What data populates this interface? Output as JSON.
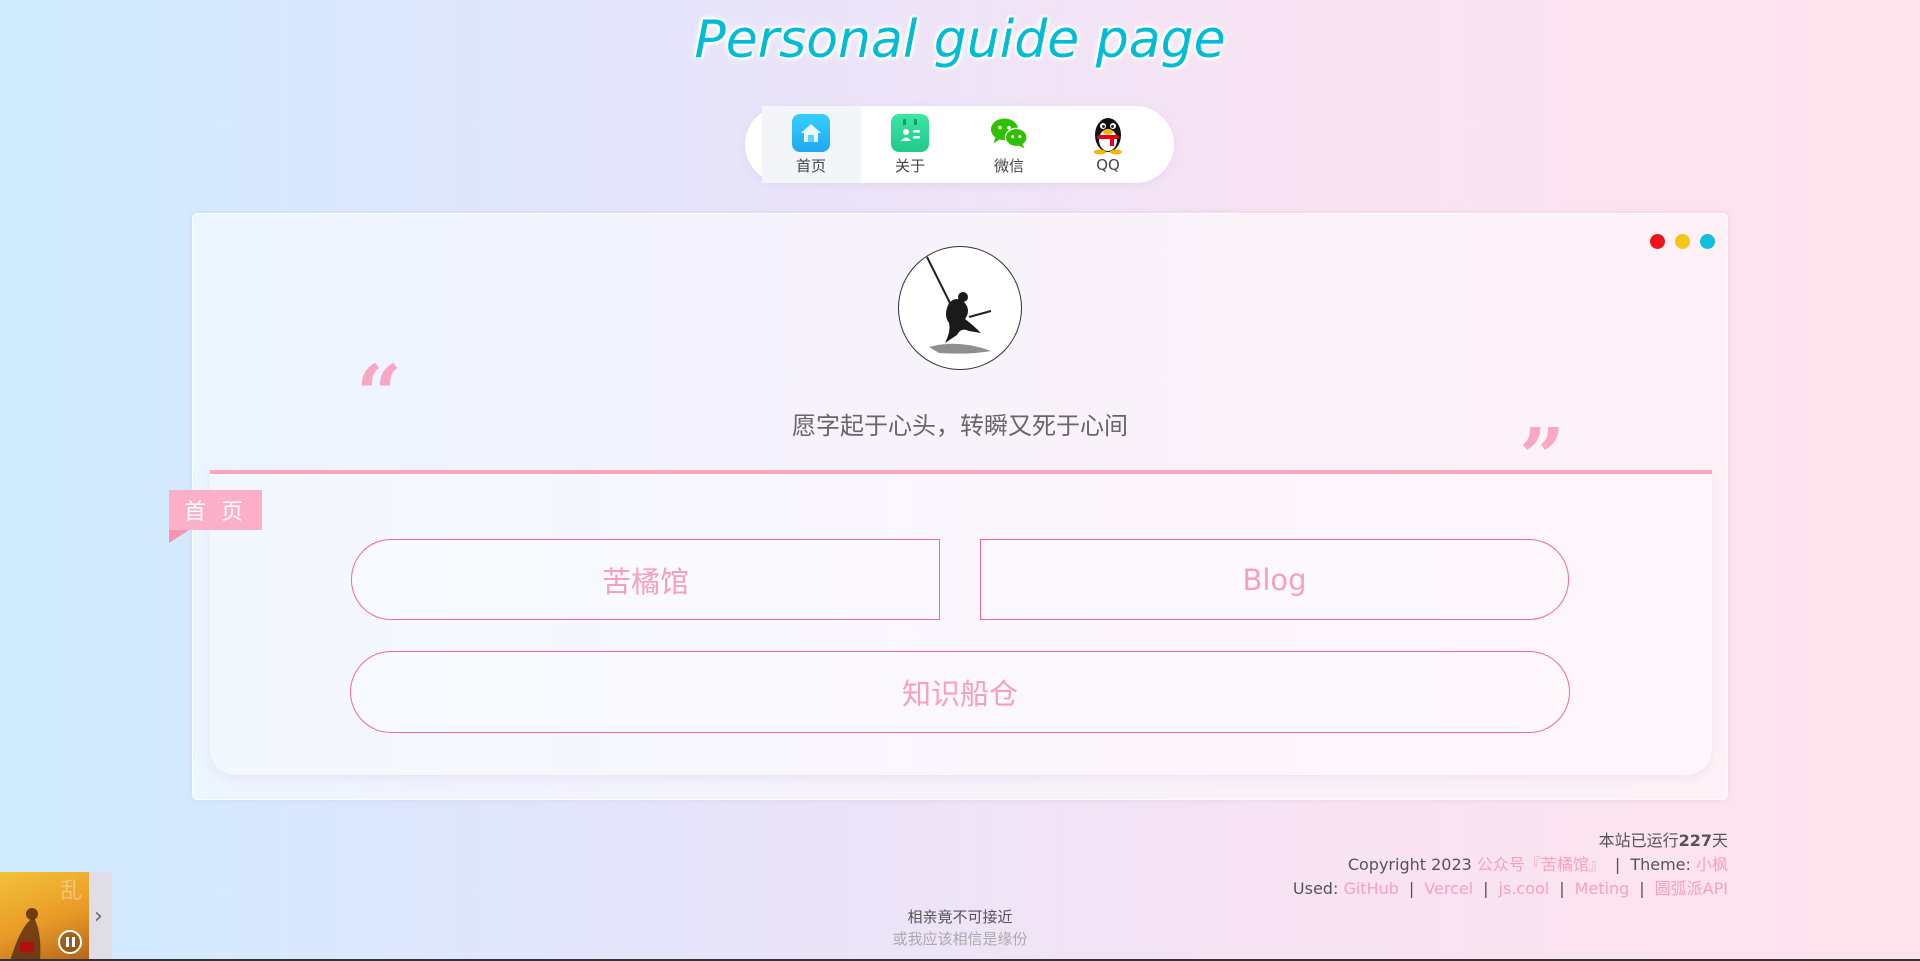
{
  "header": {
    "title": "Personal guide page"
  },
  "nav": {
    "items": [
      {
        "label": "首页",
        "icon": "home-icon",
        "active": true
      },
      {
        "label": "关于",
        "icon": "calendar-profile-icon"
      },
      {
        "label": "微信",
        "icon": "wechat-icon"
      },
      {
        "label": "QQ",
        "icon": "qq-penguin-icon"
      }
    ]
  },
  "card": {
    "window_dots": [
      "#f0141a",
      "#f5c518",
      "#12bfe0"
    ],
    "motto": "愿字起于心头，转瞬又死于心间",
    "quote_open": "“",
    "quote_close": "”",
    "section_label": "首 页",
    "links": [
      {
        "label": "苦橘馆"
      },
      {
        "label": "Blog"
      },
      {
        "label": "知识船仓"
      }
    ]
  },
  "footer": {
    "runtime_prefix": "本站已运行",
    "runtime_days": "227",
    "runtime_suffix": "天",
    "copyright_prefix": "Copyright 2023",
    "copyright_link": "公众号『苦橘馆』",
    "theme_label": "Theme:",
    "theme_link": "小枫",
    "used_label": "Used:",
    "used_links": [
      "GitHub",
      "Vercel",
      "js.cool",
      "Meting",
      "圆弧派API"
    ]
  },
  "player": {
    "lyric_current": "相亲竟不可接近",
    "lyric_next": "或我应该相信是缘份",
    "state": "playing"
  },
  "colors": {
    "accent_pink": "#f9a0bf",
    "title_cyan": "#00bcd4",
    "border_pink": "#f5679a"
  }
}
